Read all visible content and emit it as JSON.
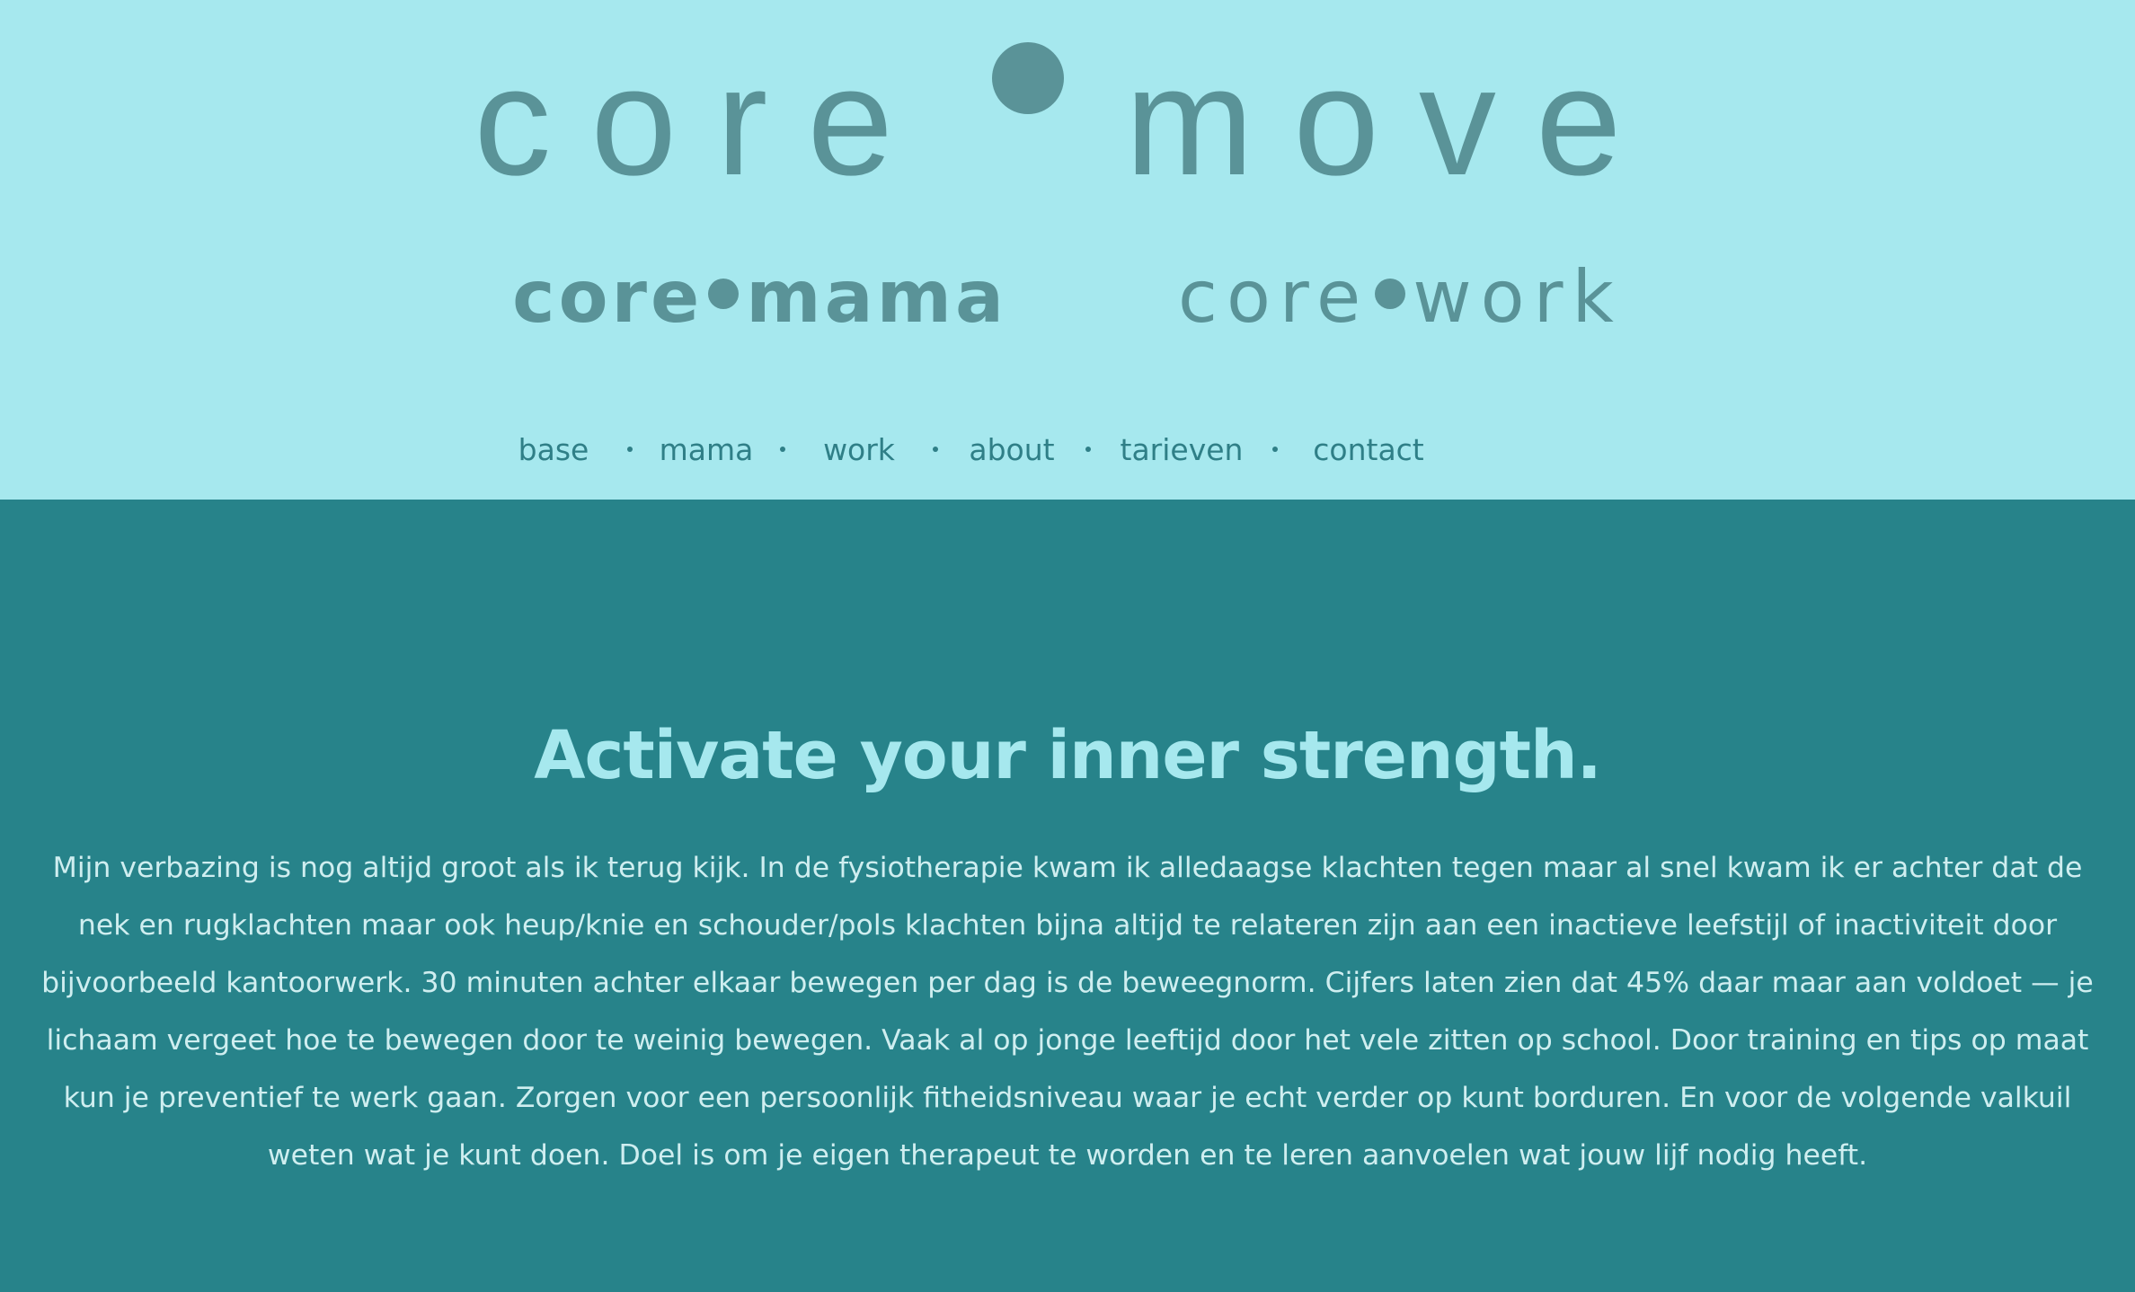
{
  "brand": {
    "logo_left": "core",
    "logo_right": "move",
    "sub_mama_left": "core",
    "sub_mama_right": "mama",
    "sub_work_left": "core",
    "sub_work_right": "work"
  },
  "nav": {
    "items": [
      {
        "label": "base"
      },
      {
        "label": "mama"
      },
      {
        "label": "work"
      },
      {
        "label": "about"
      },
      {
        "label": "tarieven"
      },
      {
        "label": "contact"
      }
    ]
  },
  "main": {
    "heading": "Activate your inner strength.",
    "paragraph": "Mijn verbazing is nog altijd groot als ik terug kijk. In de fysiotherapie kwam ik alledaagse klachten tegen maar al snel kwam ik er achter dat de nek en rugklachten maar ook heup/knie en schouder/pols klachten bijna altijd te relateren zijn aan een inactieve leefstijl of inactiviteit door bijvoorbeeld kantoorwerk. 30 minuten achter elkaar bewegen per dag is de beweegnorm. Cijfers laten zien dat 45% daar maar aan voldoet — je lichaam vergeet hoe te bewegen door te weinig bewegen. Vaak al op jonge leeftijd door het vele zitten op school. Door training en tips op maat kun je preventief te werk gaan. Zorgen voor een persoonlijk fitheidsniveau waar je echt verder op kunt borduren. En voor de volgende valkuil weten wat je kunt doen. Doel is om je eigen therapeut te worden en te leren aanvoelen wat jouw lijf nodig heeft."
  },
  "colors": {
    "header_bg": "#a6e8ee",
    "logo": "#5a9398",
    "nav_text": "#2f7f87",
    "main_bg": "#27838a",
    "heading": "#a6e8ee",
    "body_text": "#cfeef0"
  }
}
